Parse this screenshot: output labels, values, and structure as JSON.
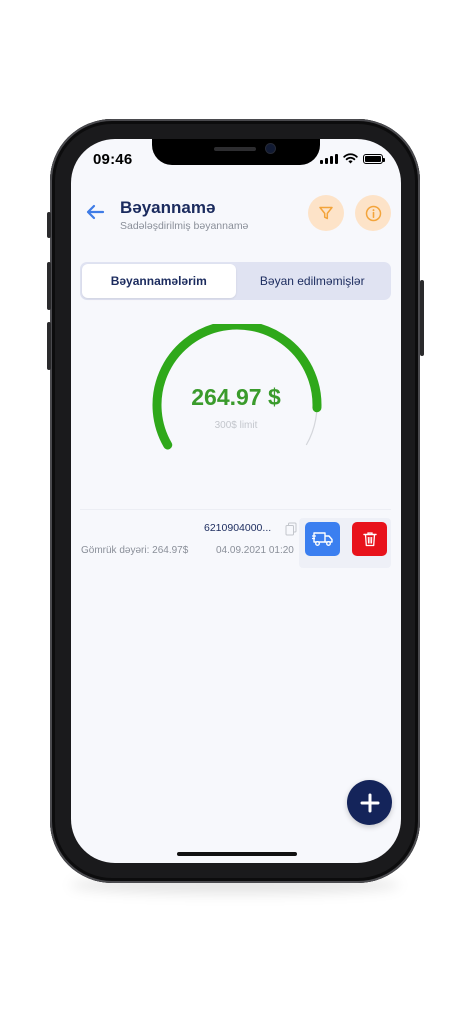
{
  "status_bar": {
    "time": "09:46"
  },
  "header": {
    "title": "Bəyannamə",
    "subtitle": "Sadələşdirilmiş bəyannamə",
    "filter_icon": "filter-icon",
    "info_icon": "info-icon",
    "back_icon": "arrow-left-icon"
  },
  "tabs": [
    {
      "label": "Bəyannamələrim",
      "active": true
    },
    {
      "label": "Bəyan edilməmişlər",
      "active": false
    }
  ],
  "gauge": {
    "value_text": "264.97 $",
    "limit_text": "300$ limit",
    "value": 264.97,
    "limit": 300,
    "color": "#2fa81a",
    "track_color": "#d4d6db"
  },
  "declarations": [
    {
      "id": "6210904000...",
      "customs_value": "Gömrük dəyəri:  264.97$",
      "date": "04.09.2021 01:20",
      "truck_button_color": "#3b7ff0",
      "delete_button_color": "#e8121b"
    }
  ],
  "fab": {
    "icon": "plus-icon"
  },
  "colors": {
    "accent": "#1b2b5e",
    "header_button_bg": "#fde3c8",
    "header_icon": "#f3a43b"
  }
}
